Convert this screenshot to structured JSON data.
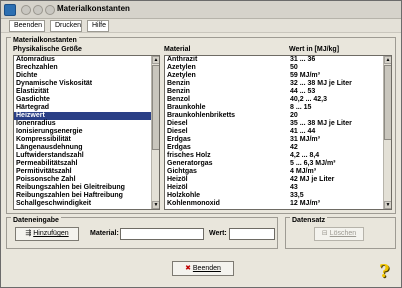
{
  "window": {
    "title": "Materialkonstanten"
  },
  "menu": {
    "beenden": "Beenden",
    "drucken": "Drucken",
    "hilfe": "Hilfe"
  },
  "material_group": {
    "title": "Materialkonstanten",
    "left_header": "Physikalische Größe",
    "material_header": "Material",
    "value_header": "Wert in [MJ/kg]"
  },
  "quantities": [
    "Atomradius",
    "Brechzahlen",
    "Dichte",
    "Dynamische Viskosität",
    "Elastizität",
    "Gasdichte",
    "Härtegrad",
    "Heizwert",
    "Ionenradius",
    "Ionisierungsenergie",
    "Kompressibilität",
    "Längenausdehnung",
    "Luftwiderstandszahl",
    "Permeabilitätszahl",
    "Permitivitätszahl",
    "Poissonsche Zahl",
    "Reibungszahlen bei Gleitreibung",
    "Reibungszahlen bei Haftreibung",
    "Schallgeschwindigkeit"
  ],
  "selected_index": 7,
  "materials": [
    {
      "material": "Anthrazit",
      "value": "31 ... 36"
    },
    {
      "material": "Azetylen",
      "value": "50"
    },
    {
      "material": "Azetylen",
      "value": "59 MJ/m³"
    },
    {
      "material": "Benzin",
      "value": "32 ... 38 MJ je Liter"
    },
    {
      "material": "Benzin",
      "value": "44 ... 53"
    },
    {
      "material": "Benzol",
      "value": "40,2 ... 42,3"
    },
    {
      "material": "Braunkohle",
      "value": "8 ... 15"
    },
    {
      "material": "Braunkohlenbriketts",
      "value": "20"
    },
    {
      "material": "Diesel",
      "value": "35 ... 38 MJ je Liter"
    },
    {
      "material": "Diesel",
      "value": "41 ... 44"
    },
    {
      "material": "Erdgas",
      "value": "31 MJ/m³"
    },
    {
      "material": "Erdgas",
      "value": "42"
    },
    {
      "material": "frisches Holz",
      "value": "4,2 ... 8,4"
    },
    {
      "material": "Generatorgas",
      "value": "5 ... 6,3 MJ/m³"
    },
    {
      "material": "Gichtgas",
      "value": "4 MJ/m³"
    },
    {
      "material": "Heizöl",
      "value": "42 MJ je Liter"
    },
    {
      "material": "Heizöl",
      "value": "43"
    },
    {
      "material": "Holzkohle",
      "value": "33,5"
    },
    {
      "material": "Kohlenmonoxid",
      "value": "12 MJ/m³"
    }
  ],
  "input_group": {
    "title": "Dateneingabe",
    "add_button": "Hinzufügen",
    "material_label": "Material:",
    "material_value": "",
    "value_label": "Wert:",
    "value_value": ""
  },
  "record_group": {
    "title": "Datensatz",
    "delete_button": "Löschen"
  },
  "footer": {
    "close_button": "Beenden"
  },
  "colors": {
    "selection": "#2a3f86",
    "window_bg": "#e9e6dc",
    "help_icon": "#f0c400"
  }
}
